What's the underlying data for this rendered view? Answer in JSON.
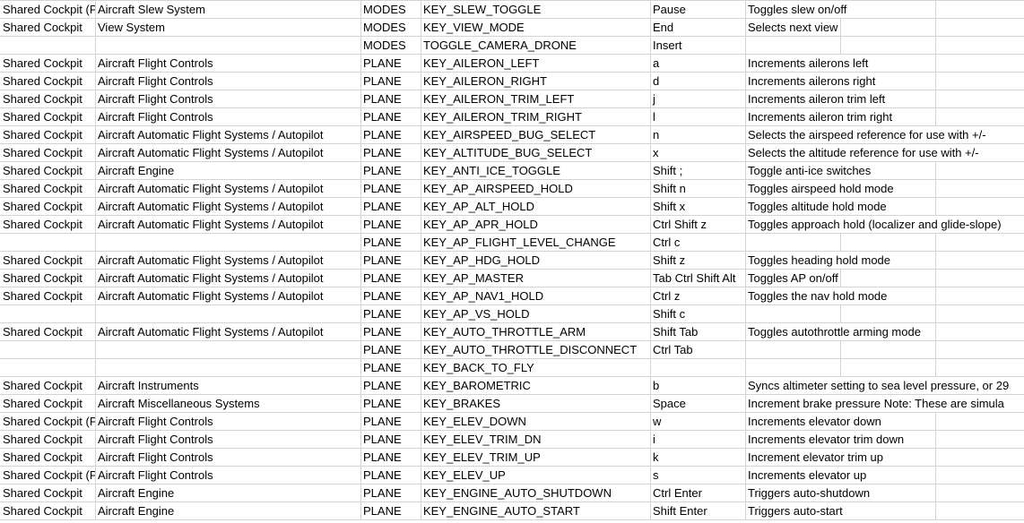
{
  "sheet": {
    "rows": [
      {
        "group": "Shared Cockpit (P",
        "category": "Aircraft Slew System",
        "context": "MODES",
        "event": "KEY_SLEW_TOGGLE",
        "key": "Pause",
        "description": "Toggles slew on/off"
      },
      {
        "group": "Shared Cockpit",
        "category": "View System",
        "context": "MODES",
        "event": "KEY_VIEW_MODE",
        "key": "End",
        "description": "Selects next view"
      },
      {
        "group": "",
        "category": "",
        "context": "MODES",
        "event": "TOGGLE_CAMERA_DRONE",
        "key": "Insert",
        "description": ""
      },
      {
        "group": "Shared Cockpit",
        "category": "Aircraft Flight Controls",
        "context": "PLANE",
        "event": "KEY_AILERON_LEFT",
        "key": "a",
        "description": "Increments ailerons left"
      },
      {
        "group": "Shared Cockpit",
        "category": "Aircraft Flight Controls",
        "context": "PLANE",
        "event": "KEY_AILERON_RIGHT",
        "key": "d",
        "description": "Increments ailerons right"
      },
      {
        "group": "Shared Cockpit",
        "category": "Aircraft Flight Controls",
        "context": "PLANE",
        "event": "KEY_AILERON_TRIM_LEFT",
        "key": "j",
        "description": "Increments aileron trim left"
      },
      {
        "group": "Shared Cockpit",
        "category": "Aircraft Flight Controls",
        "context": "PLANE",
        "event": "KEY_AILERON_TRIM_RIGHT",
        "key": "l",
        "description": "Increments aileron trim right"
      },
      {
        "group": "Shared Cockpit",
        "category": "Aircraft Automatic Flight Systems / Autopilot",
        "context": "PLANE",
        "event": "KEY_AIRSPEED_BUG_SELECT",
        "key": "n",
        "description": "Selects the airspeed reference for use with +/-"
      },
      {
        "group": "Shared Cockpit",
        "category": "Aircraft Automatic Flight Systems / Autopilot",
        "context": "PLANE",
        "event": "KEY_ALTITUDE_BUG_SELECT",
        "key": "x",
        "description": "Selects the altitude reference for use with +/-"
      },
      {
        "group": "Shared Cockpit",
        "category": "Aircraft Engine",
        "context": "PLANE",
        "event": "KEY_ANTI_ICE_TOGGLE",
        "key": "Shift ;",
        "description": "Toggle anti-ice switches"
      },
      {
        "group": "Shared Cockpit",
        "category": "Aircraft Automatic Flight Systems / Autopilot",
        "context": "PLANE",
        "event": "KEY_AP_AIRSPEED_HOLD",
        "key": "Shift n",
        "description": "Toggles airspeed hold mode"
      },
      {
        "group": "Shared Cockpit",
        "category": "Aircraft Automatic Flight Systems / Autopilot",
        "context": "PLANE",
        "event": "KEY_AP_ALT_HOLD",
        "key": "Shift x",
        "description": "Toggles altitude hold mode"
      },
      {
        "group": "Shared Cockpit",
        "category": "Aircraft Automatic Flight Systems / Autopilot",
        "context": "PLANE",
        "event": "KEY_AP_APR_HOLD",
        "key": "Ctrl Shift z",
        "description": "Toggles approach hold (localizer and glide-slope)"
      },
      {
        "group": "",
        "category": "",
        "context": "PLANE",
        "event": "KEY_AP_FLIGHT_LEVEL_CHANGE",
        "key": "Ctrl c",
        "description": ""
      },
      {
        "group": "Shared Cockpit",
        "category": "Aircraft Automatic Flight Systems / Autopilot",
        "context": "PLANE",
        "event": "KEY_AP_HDG_HOLD",
        "key": "Shift z",
        "description": "Toggles heading hold mode"
      },
      {
        "group": "Shared Cockpit",
        "category": "Aircraft Automatic Flight Systems / Autopilot",
        "context": "PLANE",
        "event": "KEY_AP_MASTER",
        "key": "Tab Ctrl Shift Alt",
        "description": "Toggles AP on/off"
      },
      {
        "group": "Shared Cockpit",
        "category": "Aircraft Automatic Flight Systems / Autopilot",
        "context": "PLANE",
        "event": "KEY_AP_NAV1_HOLD",
        "key": "Ctrl z",
        "description": "Toggles the nav hold mode"
      },
      {
        "group": "",
        "category": "",
        "context": "PLANE",
        "event": "KEY_AP_VS_HOLD",
        "key": "Shift c",
        "description": ""
      },
      {
        "group": "Shared Cockpit",
        "category": "Aircraft Automatic Flight Systems / Autopilot",
        "context": "PLANE",
        "event": "KEY_AUTO_THROTTLE_ARM",
        "key": "Shift Tab",
        "description": "Toggles autothrottle arming mode"
      },
      {
        "group": "",
        "category": "",
        "context": "PLANE",
        "event": "KEY_AUTO_THROTTLE_DISCONNECT",
        "key": "Ctrl Tab",
        "description": ""
      },
      {
        "group": "",
        "category": "",
        "context": "PLANE",
        "event": "KEY_BACK_TO_FLY",
        "key": "",
        "description": ""
      },
      {
        "group": "Shared Cockpit",
        "category": "Aircraft Instruments",
        "context": "PLANE",
        "event": "KEY_BAROMETRIC",
        "key": "b",
        "description": "Syncs altimeter setting to sea level pressure, or 29"
      },
      {
        "group": "Shared Cockpit",
        "category": "Aircraft Miscellaneous Systems",
        "context": "PLANE",
        "event": "KEY_BRAKES",
        "key": "Space",
        "description": "Increment brake pressure   Note: These are simula"
      },
      {
        "group": "Shared Cockpit (P",
        "category": "Aircraft Flight Controls",
        "context": "PLANE",
        "event": "KEY_ELEV_DOWN",
        "key": "w",
        "description": "Increments elevator down"
      },
      {
        "group": "Shared Cockpit",
        "category": "Aircraft Flight Controls",
        "context": "PLANE",
        "event": "KEY_ELEV_TRIM_DN",
        "key": "i",
        "description": "Increments elevator trim down"
      },
      {
        "group": "Shared Cockpit",
        "category": "Aircraft Flight Controls",
        "context": "PLANE",
        "event": "KEY_ELEV_TRIM_UP",
        "key": "k",
        "description": "Increment elevator trim up"
      },
      {
        "group": "Shared Cockpit (P",
        "category": "Aircraft Flight Controls",
        "context": "PLANE",
        "event": "KEY_ELEV_UP",
        "key": "s",
        "description": "Increments elevator up"
      },
      {
        "group": "Shared Cockpit",
        "category": "Aircraft Engine",
        "context": "PLANE",
        "event": "KEY_ENGINE_AUTO_SHUTDOWN",
        "key": "Ctrl Enter",
        "description": "Triggers auto-shutdown"
      },
      {
        "group": "Shared Cockpit",
        "category": "Aircraft Engine",
        "context": "PLANE",
        "event": "KEY_ENGINE_AUTO_START",
        "key": "Shift Enter",
        "description": "Triggers auto-start"
      }
    ]
  }
}
